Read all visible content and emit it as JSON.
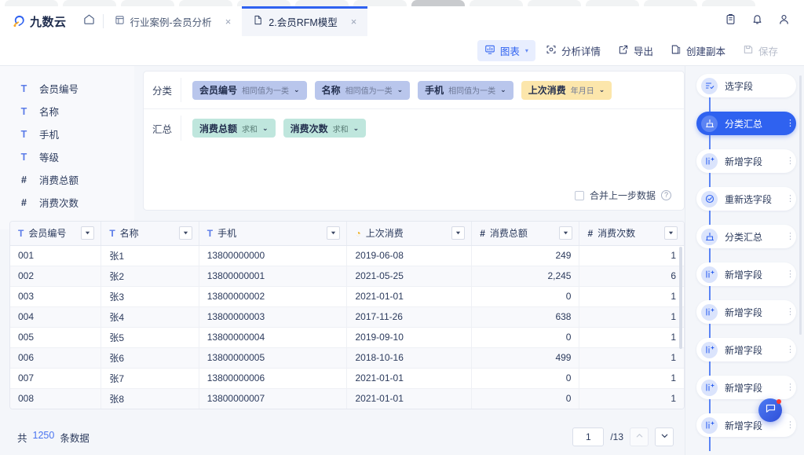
{
  "browser": {
    "tab_count": 13,
    "active_index": 7
  },
  "header": {
    "logo_text": "九数云",
    "home_icon": "home-icon",
    "tabs": [
      {
        "label": "行业案例-会员分析",
        "icon": "report-icon",
        "active": false,
        "close": "×"
      },
      {
        "label": "2.会员RFM模型",
        "icon": "doc-icon",
        "active": true,
        "close": "×"
      }
    ],
    "right_icons": [
      "clipboard-icon",
      "bell-icon",
      "user-icon"
    ]
  },
  "toolbar": {
    "items": [
      {
        "label": "图表",
        "icon": "chart-icon",
        "state": "accent",
        "caret": "▾"
      },
      {
        "label": "分析详情",
        "icon": "analysis-icon",
        "state": "normal"
      },
      {
        "label": "导出",
        "icon": "export-icon",
        "state": "normal"
      },
      {
        "label": "创建副本",
        "icon": "duplicate-icon",
        "state": "normal"
      },
      {
        "label": "保存",
        "icon": "save-icon",
        "state": "disabled"
      }
    ]
  },
  "fields": {
    "items": [
      {
        "label": "会员编号",
        "type": "text",
        "glyph": "T"
      },
      {
        "label": "名称",
        "type": "text",
        "glyph": "T"
      },
      {
        "label": "手机",
        "type": "text",
        "glyph": "T"
      },
      {
        "label": "等级",
        "type": "text",
        "glyph": "T"
      },
      {
        "label": "消费总额",
        "type": "number",
        "glyph": "#"
      },
      {
        "label": "消费次数",
        "type": "number",
        "glyph": "#"
      }
    ]
  },
  "config": {
    "dimension_label": "分类",
    "dimension_chips": [
      {
        "name": "会员编号",
        "sub": "相同值为一类",
        "style": "dim-blue",
        "caret": "⌄"
      },
      {
        "name": "名称",
        "sub": "相同值为一类",
        "style": "dim-blue",
        "caret": "⌄"
      },
      {
        "name": "手机",
        "sub": "相同值为一类",
        "style": "dim-blue",
        "caret": "⌄"
      },
      {
        "name": "上次消费",
        "sub": "年月日",
        "style": "dim-amber",
        "caret": "⌄"
      }
    ],
    "measure_label": "汇总",
    "measure_chips": [
      {
        "name": "消费总额",
        "sub": "求和",
        "style": "measure",
        "caret": "⌄"
      },
      {
        "name": "消费次数",
        "sub": "求和",
        "style": "measure",
        "caret": "⌄"
      }
    ],
    "merge_checkbox_label": "合并上一步数据",
    "merge_checked": false,
    "help_icon": "question-icon"
  },
  "table": {
    "columns": [
      {
        "label": "会员编号",
        "type": "text",
        "glyph": "T",
        "align": "left"
      },
      {
        "label": "名称",
        "type": "text",
        "glyph": "T",
        "align": "left"
      },
      {
        "label": "手机",
        "type": "text",
        "glyph": "T",
        "align": "left"
      },
      {
        "label": "上次消费",
        "type": "date",
        "glyph": "◔",
        "align": "left"
      },
      {
        "label": "消费总额",
        "type": "number",
        "glyph": "#",
        "align": "right"
      },
      {
        "label": "消费次数",
        "type": "number",
        "glyph": "#",
        "align": "right"
      }
    ],
    "rows": [
      [
        "001",
        "张1",
        "13800000000",
        "2019-06-08",
        "249",
        "1"
      ],
      [
        "002",
        "张2",
        "13800000001",
        "2021-05-25",
        "2,245",
        "6"
      ],
      [
        "003",
        "张3",
        "13800000002",
        "2021-01-01",
        "0",
        "1"
      ],
      [
        "004",
        "张4",
        "13800000003",
        "2017-11-26",
        "638",
        "1"
      ],
      [
        "005",
        "张5",
        "13800000004",
        "2019-09-10",
        "0",
        "1"
      ],
      [
        "006",
        "张6",
        "13800000005",
        "2018-10-16",
        "499",
        "1"
      ],
      [
        "007",
        "张7",
        "13800000006",
        "2021-01-01",
        "0",
        "1"
      ],
      [
        "008",
        "张8",
        "13800000007",
        "2021-01-01",
        "0",
        "1"
      ]
    ]
  },
  "pager": {
    "total_prefix": "共",
    "total_count": "1250",
    "total_suffix": "条数据",
    "current_page": "1",
    "page_of": "/13",
    "prev_icon": "chevron-up-icon",
    "next_icon": "chevron-down-icon"
  },
  "pipeline": {
    "steps": [
      {
        "label": "选字段",
        "icon": "select-field-icon",
        "active": false,
        "more": false
      },
      {
        "label": "分类汇总",
        "icon": "group-by-icon",
        "active": true,
        "more": true
      },
      {
        "label": "新增字段",
        "icon": "add-field-icon",
        "active": false,
        "more": true
      },
      {
        "label": "重新选字段",
        "icon": "reselect-field-icon",
        "active": false,
        "more": true
      },
      {
        "label": "分类汇总",
        "icon": "group-by-icon",
        "active": false,
        "more": true
      },
      {
        "label": "新增字段",
        "icon": "add-field-icon",
        "active": false,
        "more": true
      },
      {
        "label": "新增字段",
        "icon": "add-field-icon",
        "active": false,
        "more": true
      },
      {
        "label": "新增字段",
        "icon": "add-field-icon",
        "active": false,
        "more": true
      },
      {
        "label": "新增字段",
        "icon": "add-field-icon",
        "active": false,
        "more": true
      },
      {
        "label": "新增字段",
        "icon": "add-field-icon",
        "active": false,
        "more": true
      }
    ]
  },
  "fab": {
    "icon": "chat-icon",
    "badge": true
  },
  "colors": {
    "accent": "#2f62f0",
    "dimension_chip": "#b9c6ec",
    "date_chip": "#fce6ab",
    "measure_chip": "#bfe6dd",
    "text_field": "#5b7ce8",
    "number_field": "#2fc6a6"
  }
}
